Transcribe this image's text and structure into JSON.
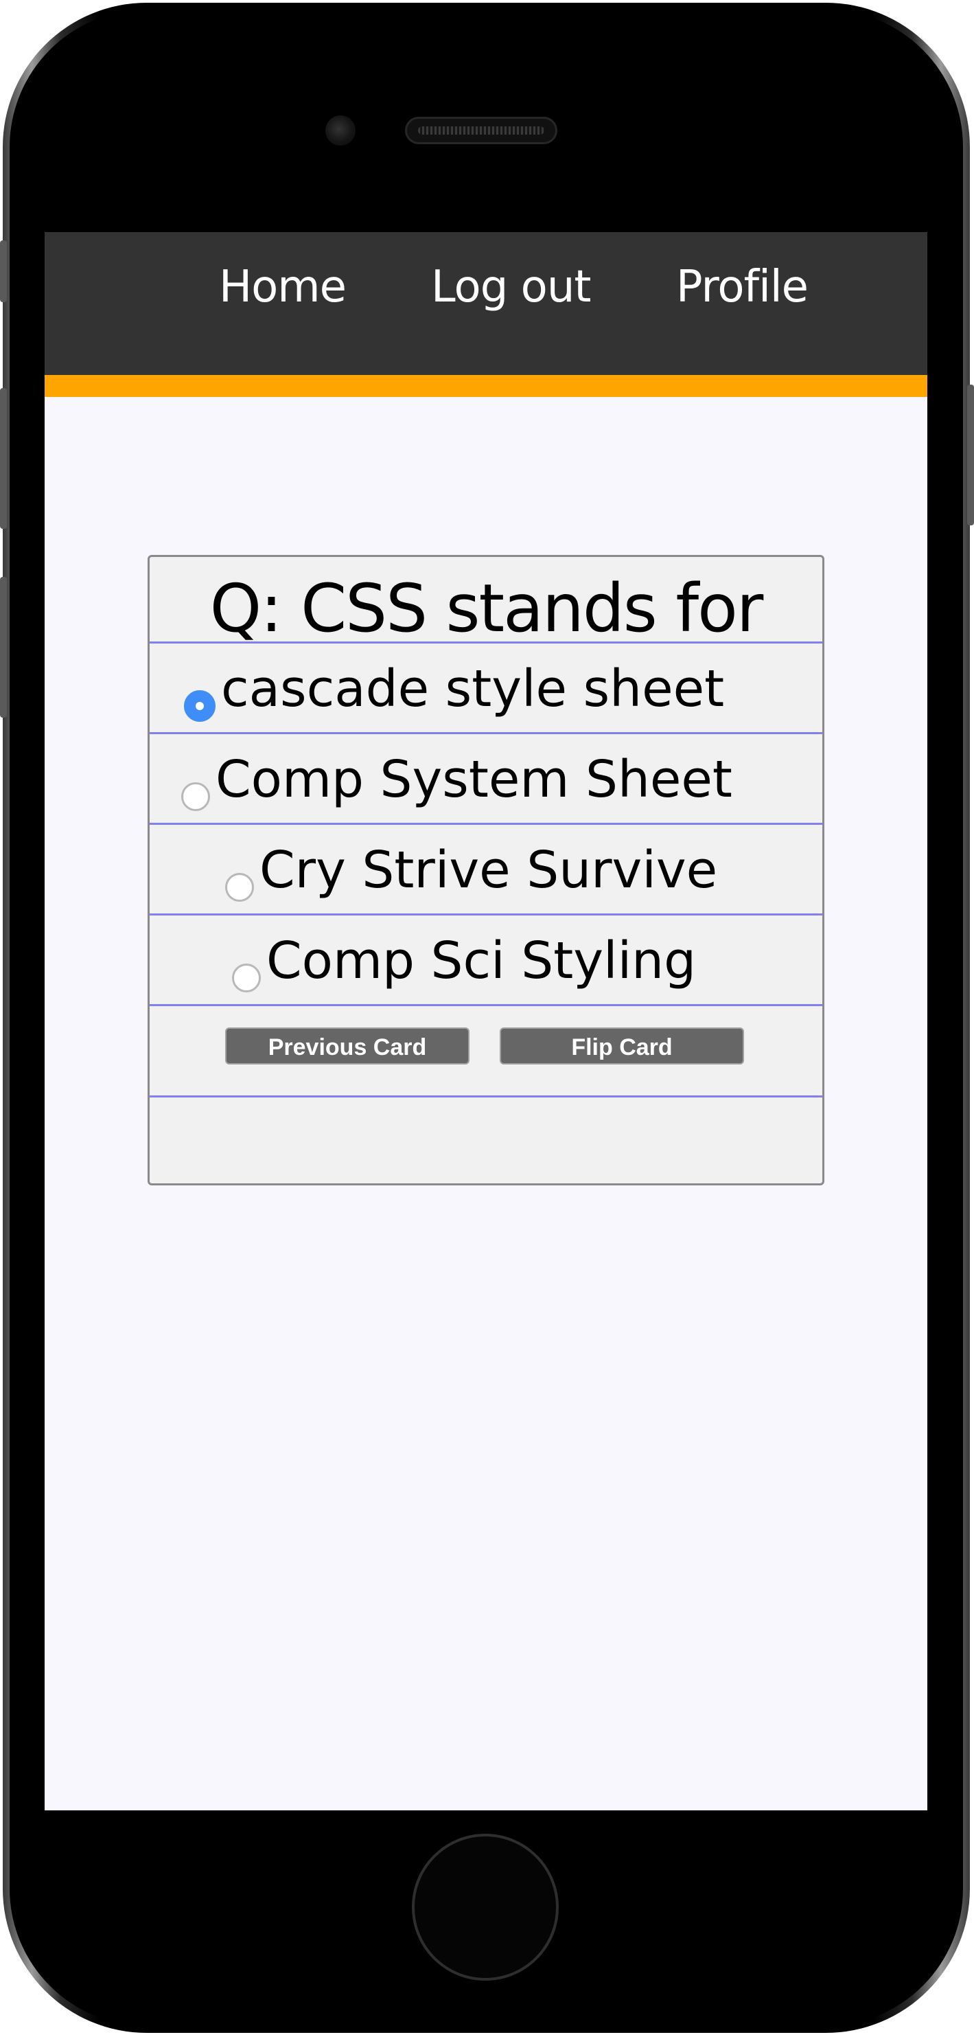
{
  "nav": {
    "items": [
      {
        "label": "Home"
      },
      {
        "label": "Log out"
      },
      {
        "label": "Profile"
      }
    ]
  },
  "card": {
    "question": "Q: CSS stands for",
    "options": [
      {
        "label": "cascade style sheet",
        "selected": true
      },
      {
        "label": "Comp System Sheet",
        "selected": false
      },
      {
        "label": "Cry Strive Survive",
        "selected": false
      },
      {
        "label": "Comp Sci Styling",
        "selected": false
      }
    ],
    "buttons": {
      "previous": "Previous Card",
      "flip": "Flip Card"
    }
  },
  "colors": {
    "navbar_bg": "#333333",
    "accent": "#ffa500",
    "screen_bg": "#f7f7fd",
    "card_bg": "#f2f1f2",
    "row_divider": "#8080f0",
    "radio_selected": "#3f8ef7",
    "button_bg": "#666666"
  }
}
